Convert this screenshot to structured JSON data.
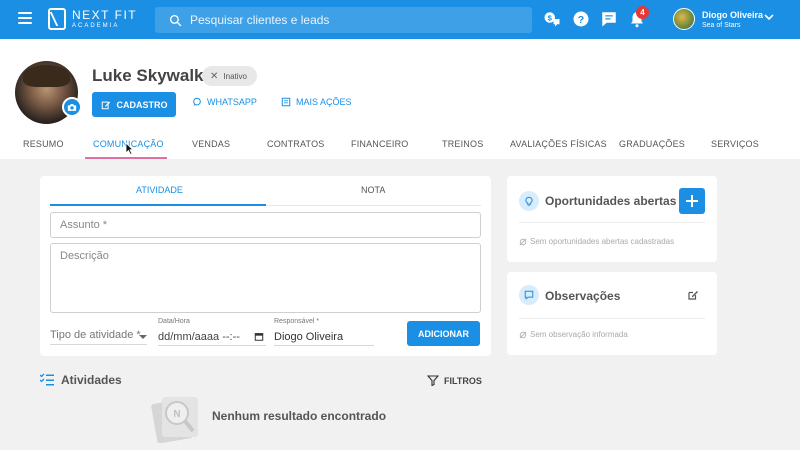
{
  "app": {
    "logo_line1": "NEXT FIT",
    "logo_line2": "ACADEMIA",
    "search_placeholder": "Pesquisar clientes e leads",
    "notification_count": "4",
    "user_name": "Diogo Oliveira",
    "user_subtitle": "Sea of Stars"
  },
  "profile": {
    "name": "Luke Skywalker",
    "status": "Inativo",
    "cadastro_label": "CADASTRO",
    "whatsapp_label": "WHATSAPP",
    "mais_acoes_label": "MAIS AÇÕES"
  },
  "tabs": [
    {
      "label": "RESUMO",
      "active": false
    },
    {
      "label": "COMUNICAÇÃO",
      "active": true
    },
    {
      "label": "VENDAS",
      "active": false
    },
    {
      "label": "CONTRATOS",
      "active": false
    },
    {
      "label": "FINANCEIRO",
      "active": false
    },
    {
      "label": "TREINOS",
      "active": false
    },
    {
      "label": "AVALIAÇÕES FÍSICAS",
      "active": false
    },
    {
      "label": "GRADUAÇÕES",
      "active": false
    },
    {
      "label": "SERVIÇOS",
      "active": false
    }
  ],
  "activity_form": {
    "tab_atividade": "ATIVIDADE",
    "tab_nota": "NOTA",
    "assunto_placeholder": "Assunto *",
    "descricao_placeholder": "Descrição",
    "tipo_placeholder": "Tipo de atividade *",
    "data_label": "Data/Hora",
    "data_value": "dd/mm/aaaa --:--",
    "responsavel_label": "Responsável *",
    "responsavel_value": "Diogo Oliveira",
    "add_button": "ADICIONAR"
  },
  "opportunities": {
    "title": "Oportunidades abertas",
    "empty": "Sem oportunidades abertas cadastradas"
  },
  "observations": {
    "title": "Observações",
    "empty": "Sem observação informada"
  },
  "activities": {
    "title": "Atividades",
    "filter_label": "FILTROS",
    "empty_message": "Nenhum resultado encontrado"
  },
  "colors": {
    "primary": "#1a8fe3",
    "tab_underline": "#e36fa1",
    "badge": "#e53935"
  }
}
